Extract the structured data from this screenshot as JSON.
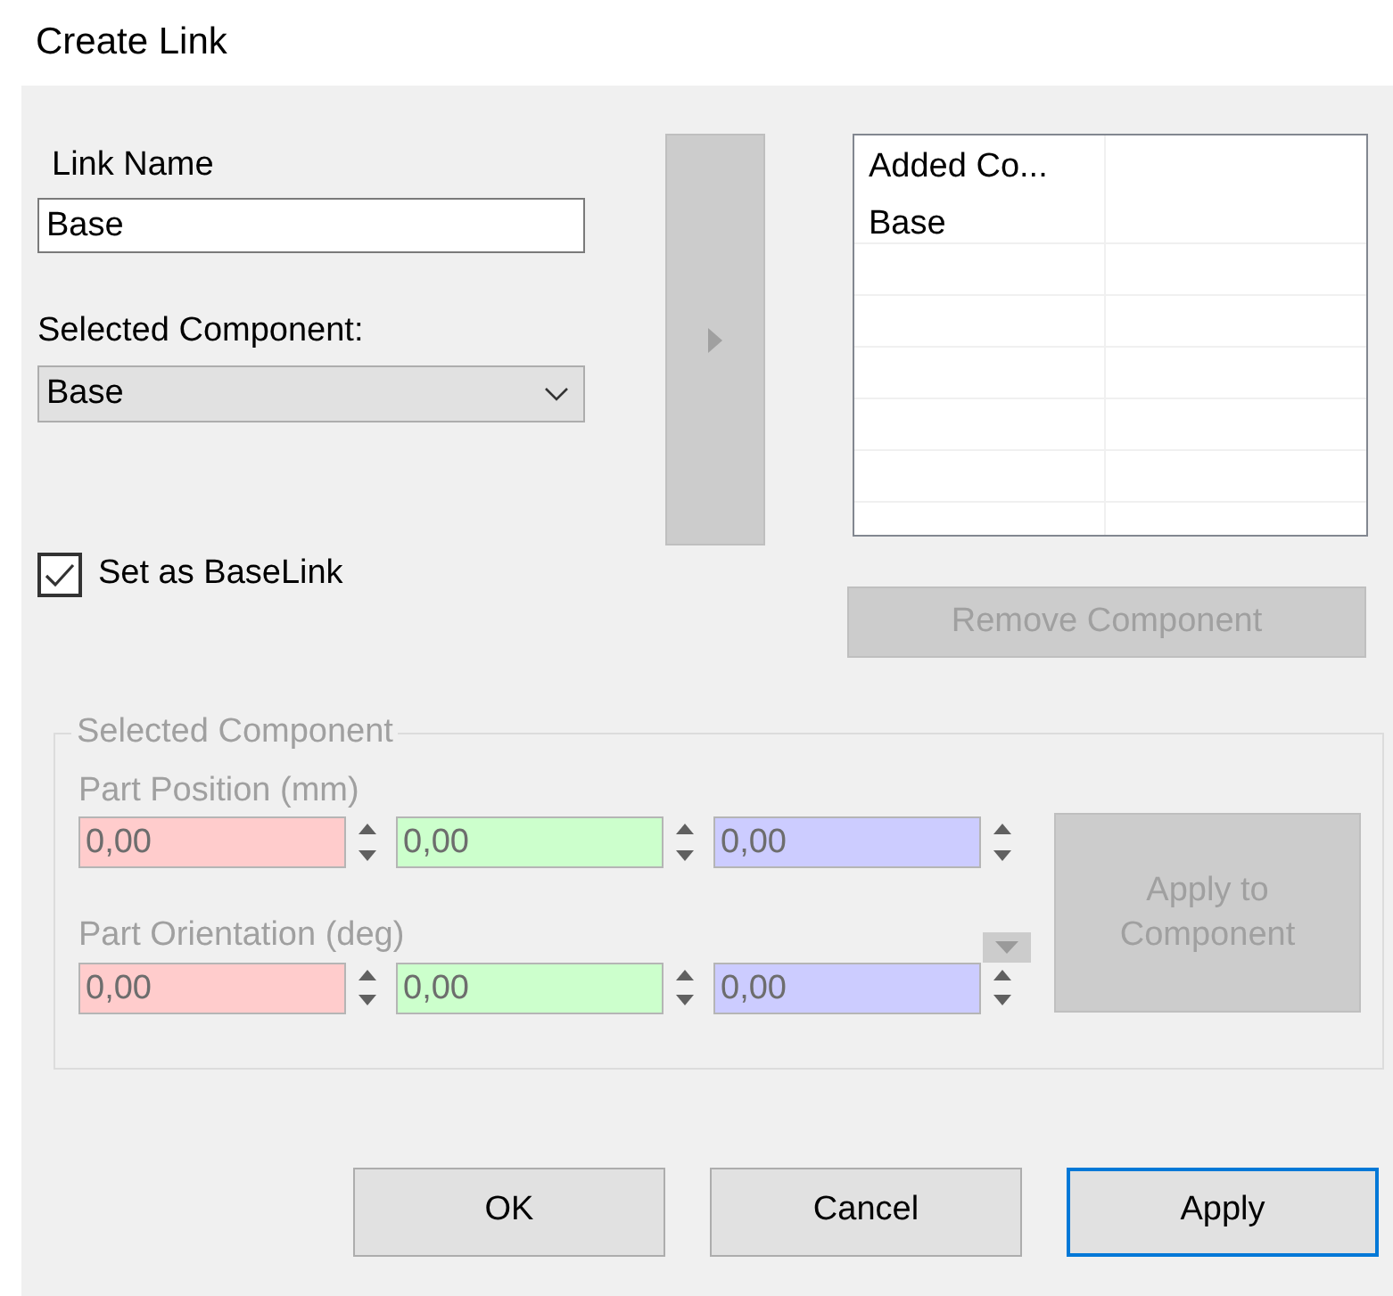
{
  "window": {
    "title": "Create Link"
  },
  "link_name": {
    "label": "Link Name",
    "value": "Base"
  },
  "selected_component": {
    "label": "Selected Component:",
    "value": "Base"
  },
  "add_button": {
    "disabled": true
  },
  "components_table": {
    "columns": [
      "Added Co..."
    ],
    "rows": [
      [
        "Base"
      ]
    ]
  },
  "base_link": {
    "label": "Set as BaseLink",
    "checked": true
  },
  "remove_button": {
    "label": "Remove Component",
    "disabled": true
  },
  "component_group": {
    "title": "Selected Component",
    "disabled": true,
    "rows": [
      {
        "label": "Part Position (mm)",
        "fields": [
          {
            "value": "0,00",
            "color": "#ffcccc"
          },
          {
            "value": "0,00",
            "color": "#ccffcc"
          },
          {
            "value": "0,00",
            "color": "#ccccff"
          }
        ]
      },
      {
        "label": "Part Orientation (deg)",
        "fields": [
          {
            "value": "0,00",
            "color": "#ffcccc"
          },
          {
            "value": "0,00",
            "color": "#ccffcc"
          },
          {
            "value": "0,00",
            "color": "#ccccff"
          }
        ]
      }
    ],
    "apply_button": {
      "label": "Apply to Component",
      "disabled": true
    }
  },
  "buttons": [
    {
      "label": "OK",
      "default": false
    },
    {
      "label": "Cancel",
      "default": false
    },
    {
      "label": "Apply",
      "default": true
    }
  ]
}
